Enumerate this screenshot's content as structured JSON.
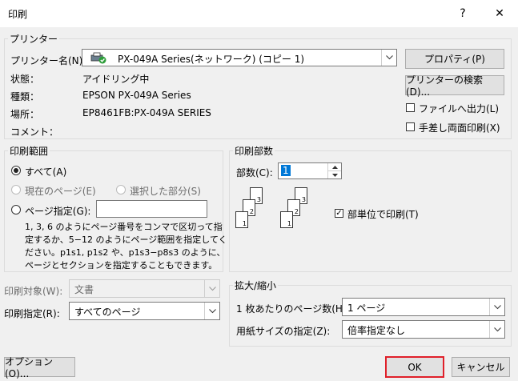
{
  "window": {
    "title": "印刷",
    "help": "?",
    "close": "✕"
  },
  "printer": {
    "group_label": "プリンター",
    "name_label": "プリンター名(N):",
    "name_value": "PX-049A Series(ネットワーク) (コピー 1)",
    "properties_button": "プロパティ(P)",
    "search_button": "プリンターの検索(D)...",
    "status_label": "状態：",
    "status_value": "アイドリング中",
    "type_label": "種類：",
    "type_value": "EPSON PX-049A Series",
    "location_label": "場所：",
    "location_value": "EP8461FB:PX-049A SERIES",
    "comment_label": "コメント：",
    "print_to_file": "ファイルへ出力(L)",
    "manual_duplex": "手差し両面印刷(X)"
  },
  "range": {
    "group_label": "印刷範囲",
    "all": "すべて(A)",
    "current_page": "現在のページ(E)",
    "selection": "選択した部分(S)",
    "pages": "ページ指定(G):",
    "pages_value": "",
    "help_text_1": "1, 3, 6 のようにページ番号をコンマで区切って指",
    "help_text_2": "定するか、5−12 のようにページ範囲を指定してく",
    "help_text_3": "ださい。p1s1, p1s2 や、p1s3−p8s3 のように、",
    "help_text_4": "ページとセクションを指定することもできます。"
  },
  "copies": {
    "group_label": "印刷部数",
    "count_label": "部数(C):",
    "count_value": "1",
    "collate": "部単位で印刷(T)",
    "collate_checked": true,
    "page_numbers": [
      "1",
      "2",
      "3"
    ]
  },
  "print_what": {
    "label": "印刷対象(W):",
    "value": "文書"
  },
  "print_spec": {
    "label": "印刷指定(R):",
    "value": "すべてのページ"
  },
  "zoom": {
    "group_label": "拡大/縮小",
    "pages_per_sheet_label": "1 枚あたりのページ数(H):",
    "pages_per_sheet_value": "1 ページ",
    "scale_label": "用紙サイズの指定(Z):",
    "scale_value": "倍率指定なし"
  },
  "footer": {
    "options": "オプション(O)...",
    "ok": "OK",
    "cancel": "キャンセル"
  },
  "colors": {
    "ok_border": "#e0202a",
    "accent": "#0078d7"
  }
}
